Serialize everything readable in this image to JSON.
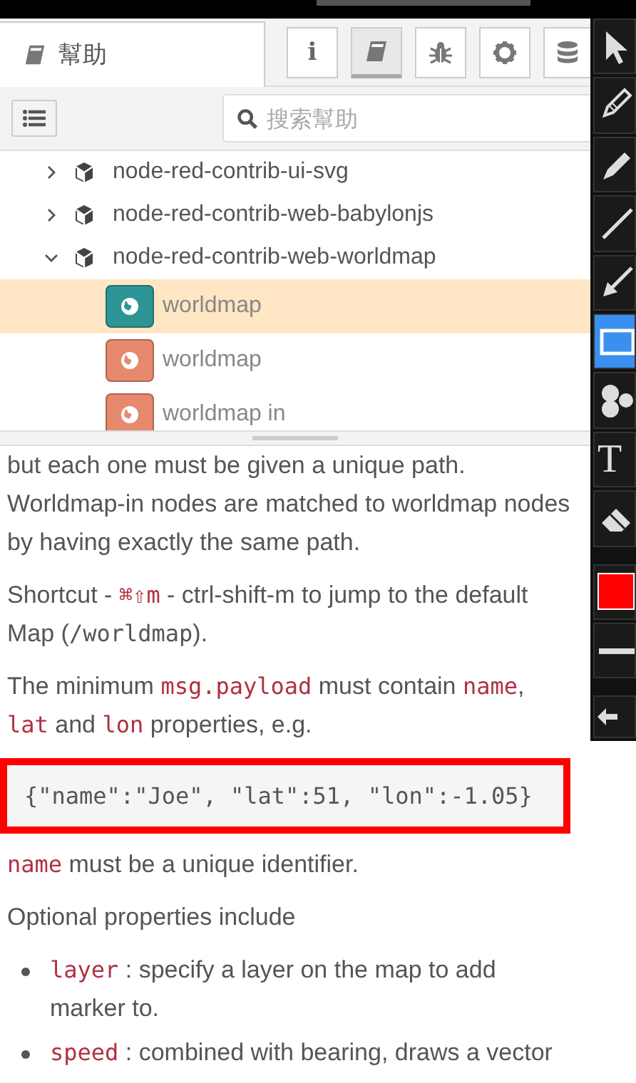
{
  "panel": {
    "tab": {
      "label": "幫助"
    },
    "buttons": [
      {
        "kind": "info",
        "label": "i",
        "selected": false
      },
      {
        "kind": "book",
        "selected": true
      },
      {
        "kind": "bug",
        "selected": false
      },
      {
        "kind": "gear",
        "selected": false
      },
      {
        "kind": "database",
        "selected": false
      }
    ],
    "search": {
      "placeholder": "搜索幫助"
    },
    "tree": [
      {
        "label": "node-red-contrib-ui-svg",
        "expanded": false
      },
      {
        "label": "node-red-contrib-web-babylonjs",
        "expanded": false
      },
      {
        "label": "node-red-contrib-web-worldmap",
        "expanded": true,
        "children": [
          {
            "label": "worldmap",
            "color": "#2e9596",
            "selected": true
          },
          {
            "label": "worldmap",
            "color": "#e6896d",
            "selected": false
          },
          {
            "label": "worldmap in",
            "color": "#e6896d",
            "selected": false
          }
        ]
      }
    ],
    "help": [
      {
        "kind": "para",
        "parts": [
          {
            "kind": "text",
            "text": "but each one must be given a unique path. Worldmap-in nodes are matched to worldmap nodes by having exactly the same path."
          }
        ]
      },
      {
        "kind": "para",
        "parts": [
          {
            "kind": "text",
            "text": "Shortcut - "
          },
          {
            "kind": "code",
            "text": "⌘⇧m"
          },
          {
            "kind": "text",
            "text": " - ctrl-shift-m to jump to the default Map ("
          },
          {
            "kind": "path",
            "text": "/worldmap"
          },
          {
            "kind": "text",
            "text": ")."
          }
        ]
      },
      {
        "kind": "para",
        "parts": [
          {
            "kind": "text",
            "text": "The minimum "
          },
          {
            "kind": "code",
            "text": "msg.payload"
          },
          {
            "kind": "text",
            "text": " must contain "
          },
          {
            "kind": "code",
            "text": "name"
          },
          {
            "kind": "text",
            "text": ", "
          },
          {
            "kind": "code",
            "text": "lat"
          },
          {
            "kind": "text",
            "text": " and "
          },
          {
            "kind": "code",
            "text": "lon"
          },
          {
            "kind": "text",
            "text": " properties, e.g."
          }
        ]
      },
      {
        "kind": "pre",
        "parts": [
          {
            "kind": "path",
            "text": "{\"name\":\"Joe\", \"lat\":51, \"lon\":-1.05}"
          }
        ],
        "highlighted": true
      },
      {
        "kind": "para",
        "parts": [
          {
            "kind": "code",
            "text": "name"
          },
          {
            "kind": "text",
            "text": " must be a unique identifier."
          }
        ]
      },
      {
        "kind": "para",
        "parts": [
          {
            "kind": "text",
            "text": "Optional properties include"
          }
        ]
      },
      {
        "kind": "list",
        "items": [
          {
            "parts": [
              {
                "kind": "code",
                "text": "layer"
              },
              {
                "kind": "text",
                "text": " : specify a layer on the map to add marker to."
              }
            ]
          },
          {
            "parts": [
              {
                "kind": "code",
                "text": "speed"
              },
              {
                "kind": "text",
                "text": " : combined with bearing, draws a vector"
              }
            ]
          }
        ]
      }
    ]
  },
  "toolbar": {
    "tools": [
      {
        "kind": "cursor",
        "selected": false
      },
      {
        "kind": "pencil",
        "selected": false
      },
      {
        "kind": "marker",
        "selected": false
      },
      {
        "kind": "line",
        "selected": false
      },
      {
        "kind": "arrow",
        "selected": false
      },
      {
        "kind": "rectangle",
        "selected": true
      },
      {
        "kind": "numbers",
        "selected": false
      },
      {
        "kind": "text",
        "label": "T",
        "selected": false
      },
      {
        "kind": "eraser",
        "selected": false
      }
    ],
    "color": "#ff0000"
  }
}
